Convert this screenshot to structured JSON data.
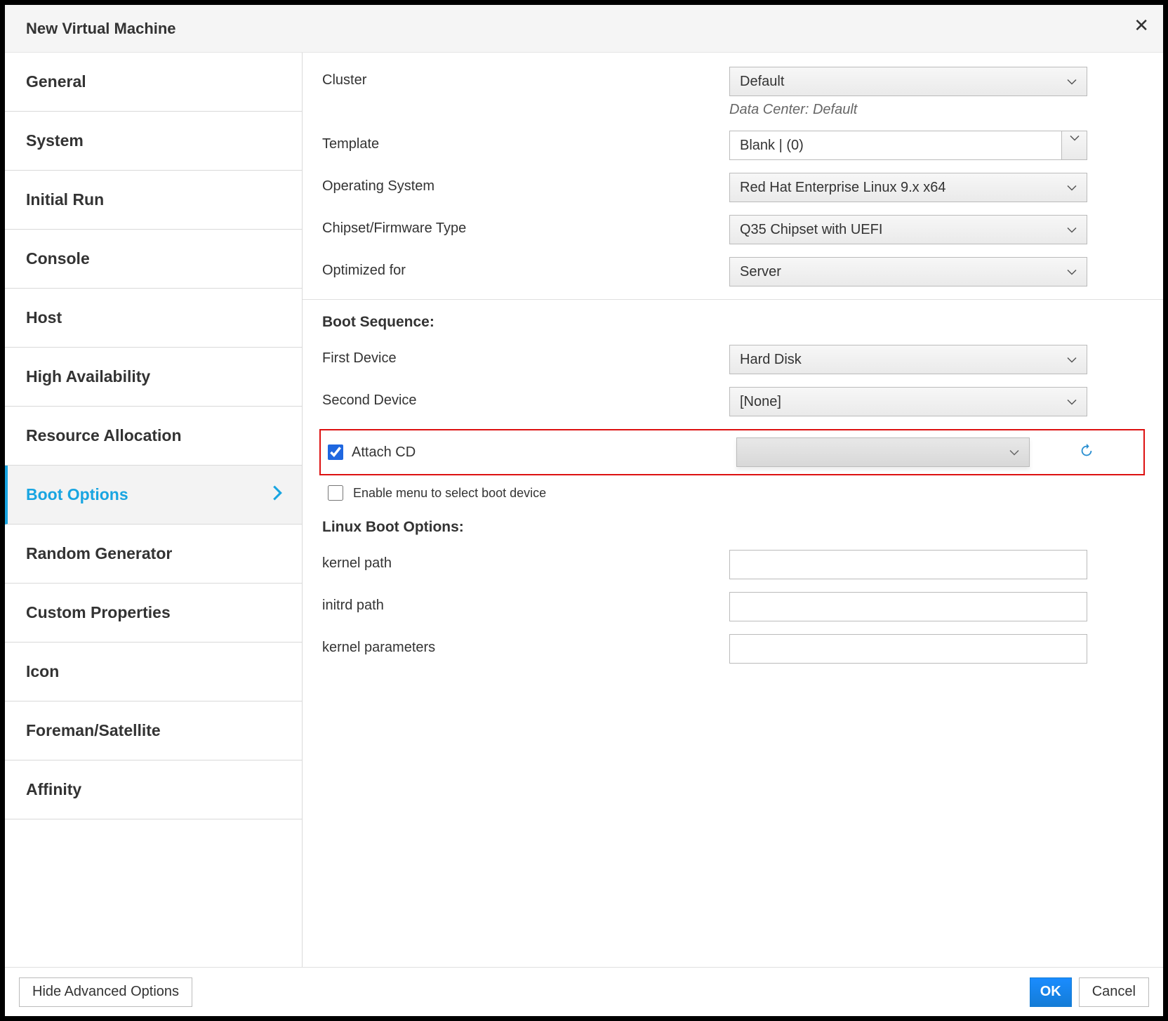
{
  "dialog": {
    "title": "New Virtual Machine"
  },
  "sidebar": {
    "items": [
      {
        "label": "General"
      },
      {
        "label": "System"
      },
      {
        "label": "Initial Run"
      },
      {
        "label": "Console"
      },
      {
        "label": "Host"
      },
      {
        "label": "High Availability"
      },
      {
        "label": "Resource Allocation"
      },
      {
        "label": "Boot Options",
        "active": true
      },
      {
        "label": "Random Generator"
      },
      {
        "label": "Custom Properties"
      },
      {
        "label": "Icon"
      },
      {
        "label": "Foreman/Satellite"
      },
      {
        "label": "Affinity"
      }
    ]
  },
  "form": {
    "cluster_label": "Cluster",
    "cluster_value": "Default",
    "data_center_line": "Data Center: Default",
    "template_label": "Template",
    "template_value": "Blank |  (0)",
    "os_label": "Operating System",
    "os_value": "Red Hat Enterprise Linux 9.x x64",
    "chipset_label": "Chipset/Firmware Type",
    "chipset_value": "Q35 Chipset with UEFI",
    "optimized_label": "Optimized for",
    "optimized_value": "Server",
    "boot_sequence_title": "Boot Sequence:",
    "first_device_label": "First Device",
    "first_device_value": "Hard Disk",
    "second_device_label": "Second Device",
    "second_device_value": "[None]",
    "attach_cd_label": "Attach CD",
    "attach_cd_checked": true,
    "enable_boot_menu_label": "Enable menu to select boot device",
    "enable_boot_menu_checked": false,
    "linux_boot_title": "Linux Boot Options:",
    "kernel_path_label": "kernel path",
    "kernel_path_value": "",
    "initrd_path_label": "initrd path",
    "initrd_path_value": "",
    "kernel_params_label": "kernel parameters",
    "kernel_params_value": ""
  },
  "footer": {
    "hide_advanced": "Hide Advanced Options",
    "ok": "OK",
    "cancel": "Cancel"
  }
}
